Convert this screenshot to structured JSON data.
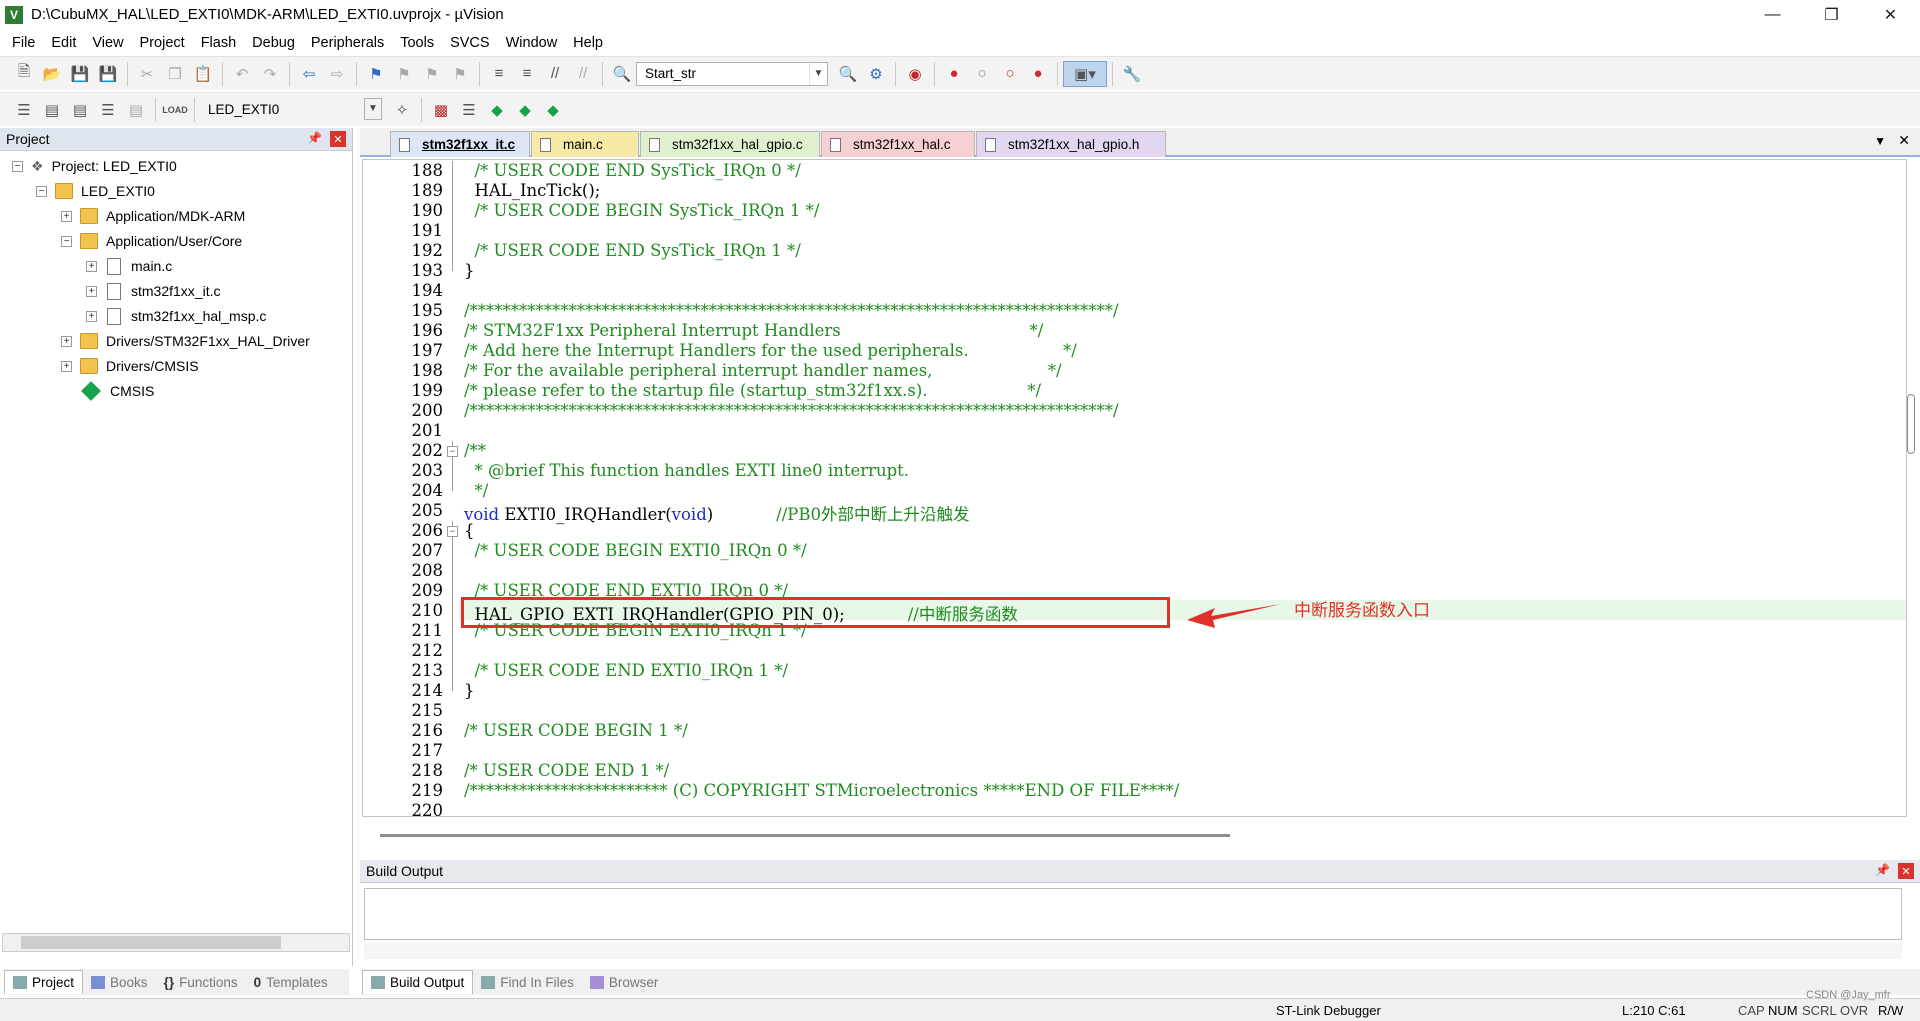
{
  "window": {
    "title": "D:\\CubuMX_HAL\\LED_EXTI0\\MDK-ARM\\LED_EXTI0.uvprojx - µVision",
    "app_icon": "V"
  },
  "menu": [
    "File",
    "Edit",
    "View",
    "Project",
    "Flash",
    "Debug",
    "Peripherals",
    "Tools",
    "SVCS",
    "Window",
    "Help"
  ],
  "toolbar": {
    "find_combo_value": "Start_str",
    "target_combo_value": "LED_EXTI0"
  },
  "project_panel": {
    "title": "Project",
    "tree": [
      {
        "label": "Project: LED_EXTI0",
        "depth": 0,
        "expander": "-",
        "icon": "project-icon"
      },
      {
        "label": "LED_EXTI0",
        "depth": 1,
        "expander": "-",
        "icon": "target-icon"
      },
      {
        "label": "Application/MDK-ARM",
        "depth": 2,
        "expander": "+",
        "icon": "folder-icon"
      },
      {
        "label": "Application/User/Core",
        "depth": 2,
        "expander": "-",
        "icon": "folder-icon"
      },
      {
        "label": "main.c",
        "depth": 3,
        "expander": "+",
        "icon": "file-icon"
      },
      {
        "label": "stm32f1xx_it.c",
        "depth": 3,
        "expander": "+",
        "icon": "file-icon"
      },
      {
        "label": "stm32f1xx_hal_msp.c",
        "depth": 3,
        "expander": "+",
        "icon": "file-icon"
      },
      {
        "label": "Drivers/STM32F1xx_HAL_Driver",
        "depth": 2,
        "expander": "+",
        "icon": "folder-icon"
      },
      {
        "label": "Drivers/CMSIS",
        "depth": 2,
        "expander": "+",
        "icon": "folder-icon"
      },
      {
        "label": "CMSIS",
        "depth": 2,
        "expander": "",
        "icon": "diamond-icon"
      }
    ],
    "bottom_tabs": [
      "Project",
      "Books",
      "Functions",
      "Templates"
    ]
  },
  "editor": {
    "tabs": [
      {
        "label": "stm32f1xx_it.c",
        "color": "#dce6f4",
        "active": true
      },
      {
        "label": "main.c",
        "color": "#f7e9a6"
      },
      {
        "label": "stm32f1xx_hal_gpio.c",
        "color": "#dff0cf"
      },
      {
        "label": "stm32f1xx_hal.c",
        "color": "#f5cfd2"
      },
      {
        "label": "stm32f1xx_hal_gpio.h",
        "color": "#e2d6f0"
      }
    ],
    "lines": [
      {
        "n": "188",
        "text": "  /* USER CODE END SysTick_IRQn 0 */"
      },
      {
        "n": "189",
        "text": "  HAL_IncTick();"
      },
      {
        "n": "190",
        "text": "  /* USER CODE BEGIN SysTick_IRQn 1 */"
      },
      {
        "n": "191",
        "text": ""
      },
      {
        "n": "192",
        "text": "  /* USER CODE END SysTick_IRQn 1 */"
      },
      {
        "n": "193",
        "text": "}"
      },
      {
        "n": "194",
        "text": ""
      },
      {
        "n": "195",
        "text": "/******************************************************************************/"
      },
      {
        "n": "196",
        "text": "/* STM32F1xx Peripheral Interrupt Handlers                                    */"
      },
      {
        "n": "197",
        "text": "/* Add here the Interrupt Handlers for the used peripherals.                  */"
      },
      {
        "n": "198",
        "text": "/* For the available peripheral interrupt handler names,                      */"
      },
      {
        "n": "199",
        "text": "/* please refer to the startup file (startup_stm32f1xx.s).                   */"
      },
      {
        "n": "200",
        "text": "/******************************************************************************/"
      },
      {
        "n": "201",
        "text": ""
      },
      {
        "n": "202",
        "text": "/**"
      },
      {
        "n": "203",
        "text": "  * @brief This function handles EXTI line0 interrupt."
      },
      {
        "n": "204",
        "text": "  */"
      },
      {
        "n": "205",
        "text": "void EXTI0_IRQHandler(void)            //PB0外部中断上升沿触发"
      },
      {
        "n": "206",
        "text": "{"
      },
      {
        "n": "207",
        "text": "  /* USER CODE BEGIN EXTI0_IRQn 0 */"
      },
      {
        "n": "208",
        "text": ""
      },
      {
        "n": "209",
        "text": "  /* USER CODE END EXTI0_IRQn 0 */"
      },
      {
        "n": "210",
        "text": "  HAL_GPIO_EXTI_IRQHandler(GPIO_PIN_0);            //中断服务函数"
      },
      {
        "n": "211",
        "text": "  /* USER CODE BEGIN EXTI0_IRQn 1 */"
      },
      {
        "n": "212",
        "text": ""
      },
      {
        "n": "213",
        "text": "  /* USER CODE END EXTI0_IRQn 1 */"
      },
      {
        "n": "214",
        "text": "}"
      },
      {
        "n": "215",
        "text": ""
      },
      {
        "n": "216",
        "text": "/* USER CODE BEGIN 1 */"
      },
      {
        "n": "217",
        "text": ""
      },
      {
        "n": "218",
        "text": "/* USER CODE END 1 */"
      },
      {
        "n": "219",
        "text": "/************************ (C) COPYRIGHT STMicroelectronics *****END OF FILE****/"
      },
      {
        "n": "220",
        "text": ""
      }
    ],
    "annotation": "中断服务函数入口"
  },
  "build_output": {
    "title": "Build Output",
    "bottom_tabs": [
      "Build Output",
      "Find In Files",
      "Browser"
    ]
  },
  "statusbar": {
    "debugger": "ST-Link Debugger",
    "position": "L:210 C:61",
    "caps": "CAP",
    "num": "NUM",
    "scrl": "SCRL",
    "ovr": "OVR",
    "rw": "R/W",
    "watermark": "CSDN @Jay_mfr"
  }
}
